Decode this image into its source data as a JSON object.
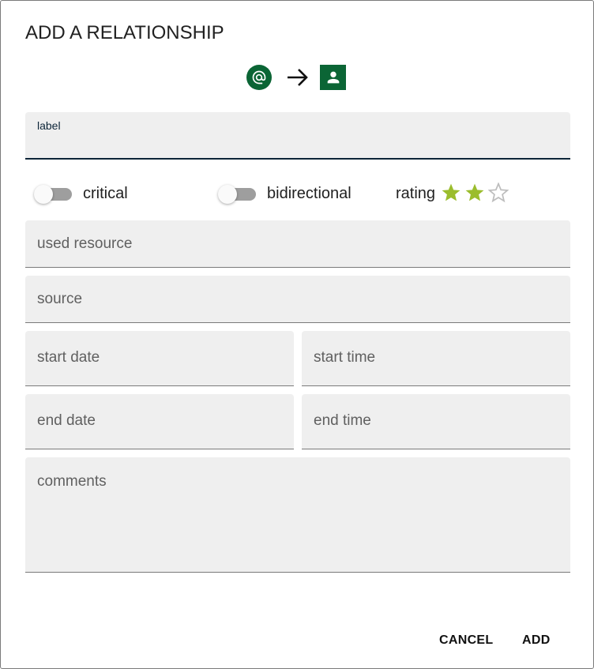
{
  "dialog": {
    "title": "ADD A RELATIONSHIP",
    "source_icon": "at-sign-icon",
    "arrow_icon": "arrow-right-icon",
    "target_icon": "person-icon",
    "accent_color": "#0b6535"
  },
  "fields": {
    "label": {
      "label": "label",
      "value": ""
    },
    "used_resource": {
      "placeholder": "used resource",
      "value": ""
    },
    "source": {
      "placeholder": "source",
      "value": ""
    },
    "start_date": {
      "placeholder": "start date",
      "value": ""
    },
    "start_time": {
      "placeholder": "start time",
      "value": ""
    },
    "end_date": {
      "placeholder": "end date",
      "value": ""
    },
    "end_time": {
      "placeholder": "end time",
      "value": ""
    },
    "comments": {
      "placeholder": "comments",
      "value": ""
    }
  },
  "toggles": {
    "critical": {
      "label": "critical",
      "on": false
    },
    "bidirectional": {
      "label": "bidirectional",
      "on": false
    }
  },
  "rating": {
    "label": "rating",
    "value": 2,
    "max": 3,
    "filled_color": "#9bbd2d",
    "empty_color": "#bdbdbd"
  },
  "actions": {
    "cancel_label": "CANCEL",
    "add_label": "ADD"
  }
}
